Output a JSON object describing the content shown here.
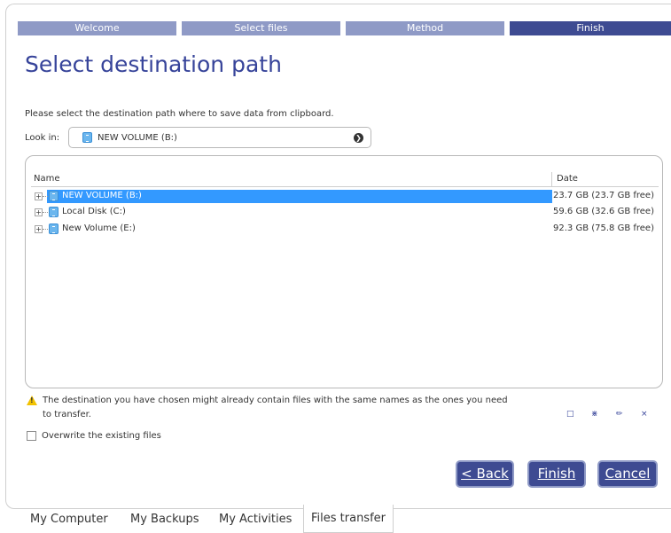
{
  "wizard": {
    "steps": [
      {
        "label": "Welcome",
        "active": false
      },
      {
        "label": "Select files",
        "active": false
      },
      {
        "label": "Method",
        "active": false
      },
      {
        "label": "Finish",
        "active": true
      }
    ]
  },
  "page": {
    "title": "Select destination path",
    "instruction": "Please select the destination path where to save data from clipboard."
  },
  "lookin": {
    "label": "Look in:",
    "value": "NEW VOLUME (B:)",
    "icon": "drive-icon"
  },
  "tree": {
    "columns": {
      "name": "Name",
      "date": "Date"
    },
    "rows": [
      {
        "name": "NEW VOLUME (B:)",
        "date": "23.7 GB (23.7 GB free)",
        "selected": true,
        "icon": "drive-icon"
      },
      {
        "name": "Local Disk (C:)",
        "date": "59.6 GB (32.6 GB free)",
        "selected": false,
        "icon": "drive-icon"
      },
      {
        "name": "New Volume (E:)",
        "date": "92.3 GB (75.8 GB free)",
        "selected": false,
        "icon": "drive-icon"
      }
    ]
  },
  "warning": {
    "line1": "The destination you have chosen might already contain files with the same names as the ones you need",
    "line2": "to transfer.",
    "icon": "warning-icon"
  },
  "mini_tools": [
    "folder-icon",
    "network-icon",
    "pencil-icon",
    "close-icon"
  ],
  "overwrite": {
    "label": "Overwrite the existing files",
    "checked": false
  },
  "buttons": {
    "back": "< Back",
    "finish": "Finish",
    "cancel": "Cancel"
  },
  "bottom_tabs": [
    {
      "label": "My Computer",
      "active": false
    },
    {
      "label": "My Backups",
      "active": false
    },
    {
      "label": "My Activities",
      "active": false
    },
    {
      "label": "Files transfer",
      "active": true
    }
  ],
  "colors": {
    "accent": "#3e4b92",
    "step_inactive": "#8f9ac6",
    "selection": "#3399ff",
    "title": "#37449a"
  }
}
